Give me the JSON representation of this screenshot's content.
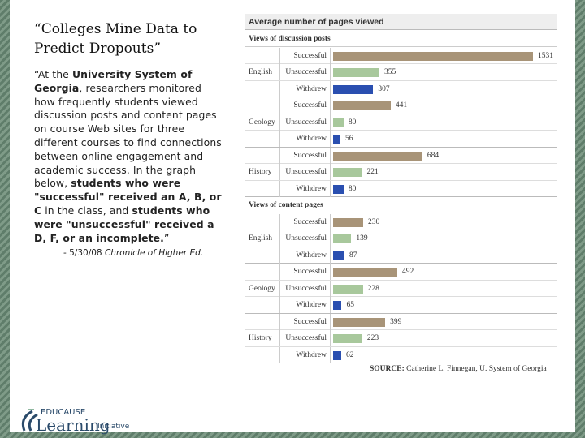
{
  "slide": {
    "title": "“Colleges Mine Data to Predict Dropouts”",
    "quote_parts": [
      {
        "t": "“At the ",
        "b": false
      },
      {
        "t": "University System of Georgia",
        "b": true
      },
      {
        "t": ", researchers monitored how frequently students viewed discussion posts and content pages on course Web sites for three different courses to find connections between online engagement and academic success. In the graph below, ",
        "b": false
      },
      {
        "t": "students who were \"successful\" received an A, B, or C",
        "b": true
      },
      {
        "t": " in the class, and ",
        "b": false
      },
      {
        "t": "students who were \"unsuccessful\" received a D, F, or an incomplete.",
        "b": true
      },
      {
        "t": "”",
        "b": false
      }
    ],
    "citation_prefix": "- 5/30/08 ",
    "citation_source": "Chronicle of Higher Ed.",
    "logo_top": "EDUCAUSE",
    "logo_main": "Learning",
    "logo_sub": "Initiative"
  },
  "chart_data": {
    "type": "bar",
    "orientation": "horizontal",
    "title": "Average number of pages viewed",
    "source_label": "SOURCE:",
    "source": "Catherine L. Finnegan, U. System of Georgia",
    "colors": {
      "Successful": "#a89478",
      "Unsuccessful": "#a8c89c",
      "Withdrew": "#2a4fb0"
    },
    "sections": [
      {
        "name": "Views of discussion posts",
        "groups": [
          {
            "name": "English",
            "values": {
              "Successful": 1531,
              "Unsuccessful": 355,
              "Withdrew": 307
            }
          },
          {
            "name": "Geology",
            "values": {
              "Successful": 441,
              "Unsuccessful": 80,
              "Withdrew": 56
            }
          },
          {
            "name": "History",
            "values": {
              "Successful": 684,
              "Unsuccessful": 221,
              "Withdrew": 80
            }
          }
        ]
      },
      {
        "name": "Views of content pages",
        "groups": [
          {
            "name": "English",
            "values": {
              "Successful": 230,
              "Unsuccessful": 139,
              "Withdrew": 87
            }
          },
          {
            "name": "Geology",
            "values": {
              "Successful": 492,
              "Unsuccessful": 228,
              "Withdrew": 65
            }
          },
          {
            "name": "History",
            "values": {
              "Successful": 399,
              "Unsuccessful": 223,
              "Withdrew": 62
            }
          }
        ]
      }
    ],
    "categories": [
      "Successful",
      "Unsuccessful",
      "Withdrew"
    ]
  }
}
